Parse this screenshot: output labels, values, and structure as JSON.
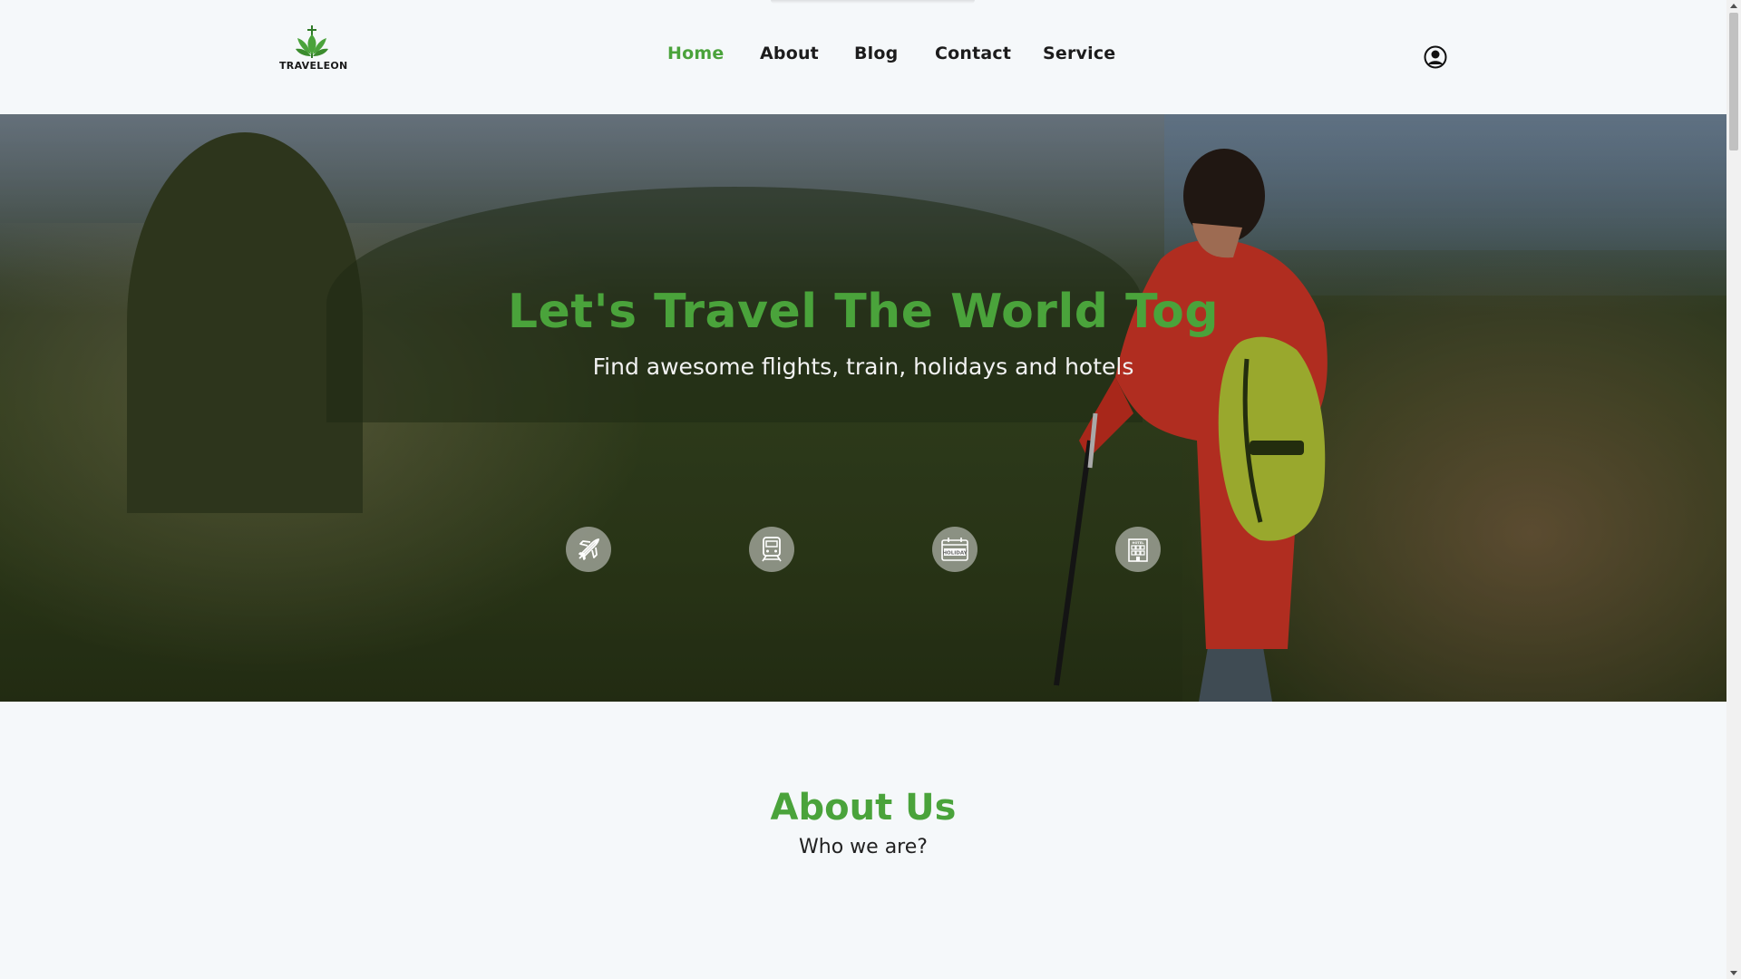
{
  "brand": {
    "name": "TRAVELEON",
    "accent": "#4aa33b"
  },
  "nav": {
    "items": [
      {
        "label": "Home",
        "active": true
      },
      {
        "label": "About",
        "active": false
      },
      {
        "label": "Blog",
        "active": false
      },
      {
        "label": "Contact",
        "active": false
      },
      {
        "label": "Service",
        "active": false
      }
    ],
    "user_icon": "user-circle-icon"
  },
  "hero": {
    "title": "Let's Travel The World Tog",
    "subtitle": "Find awesome flights, train, holidays and hotels",
    "services": [
      {
        "icon": "airplane-icon"
      },
      {
        "icon": "train-icon"
      },
      {
        "icon": "holiday-calendar-icon",
        "badge": "HOLIDAY"
      },
      {
        "icon": "hotel-icon",
        "badge": "HOTEL"
      }
    ]
  },
  "about": {
    "title": "About Us",
    "subtitle": "Who we are?"
  }
}
